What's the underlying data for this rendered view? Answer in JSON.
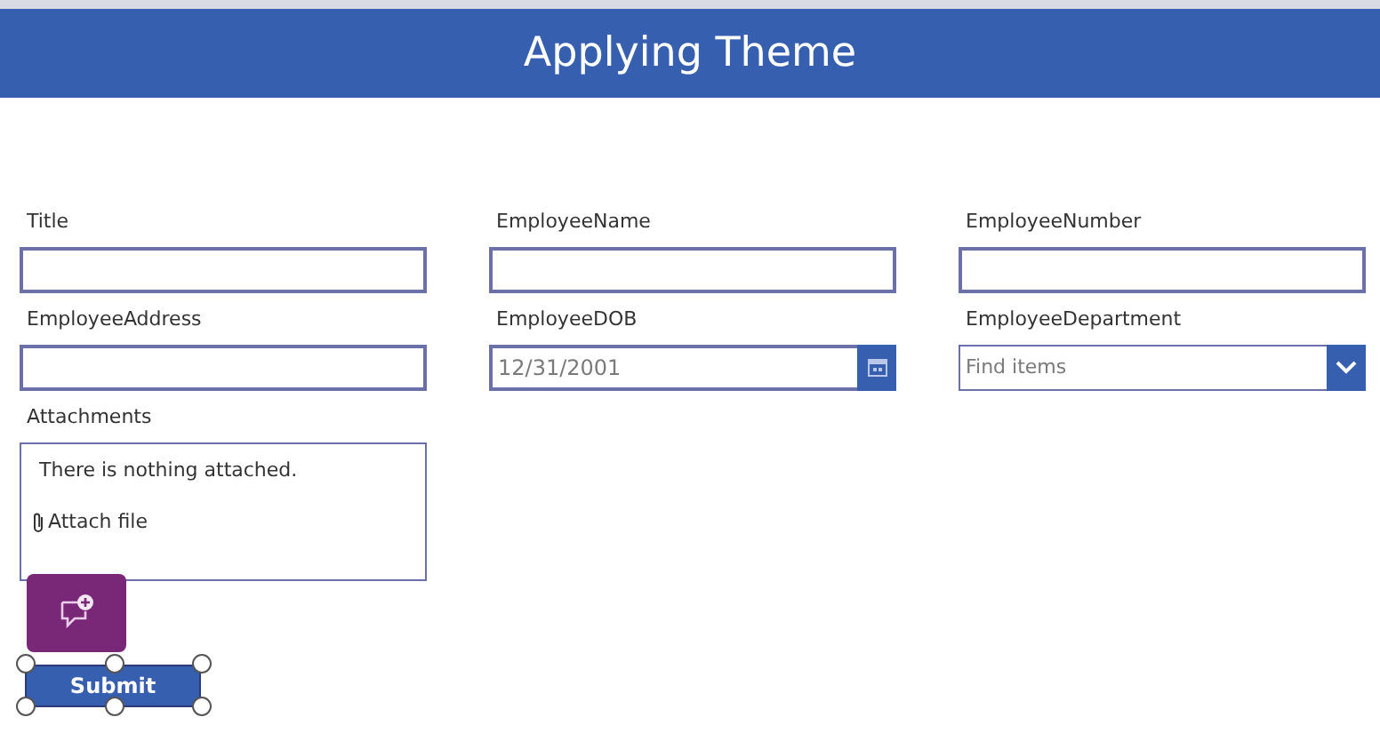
{
  "header": {
    "title": "Applying Theme"
  },
  "fields": [
    {
      "label": "Title",
      "kind": "text"
    },
    {
      "label": "EmployeeName",
      "kind": "text"
    },
    {
      "label": "EmployeeNumber",
      "kind": "text"
    },
    {
      "label": "EmployeeAddress",
      "kind": "text"
    },
    {
      "label": "EmployeeDOB",
      "kind": "date",
      "value": "12/31/2001"
    },
    {
      "label": "EmployeeDepartment",
      "kind": "dropdown",
      "placeholder": "Find items"
    },
    {
      "label": "Attachments",
      "kind": "attachments",
      "message": "There is nothing attached.",
      "action": "Attach file"
    }
  ],
  "submit": {
    "label": "Submit",
    "selected": true
  }
}
